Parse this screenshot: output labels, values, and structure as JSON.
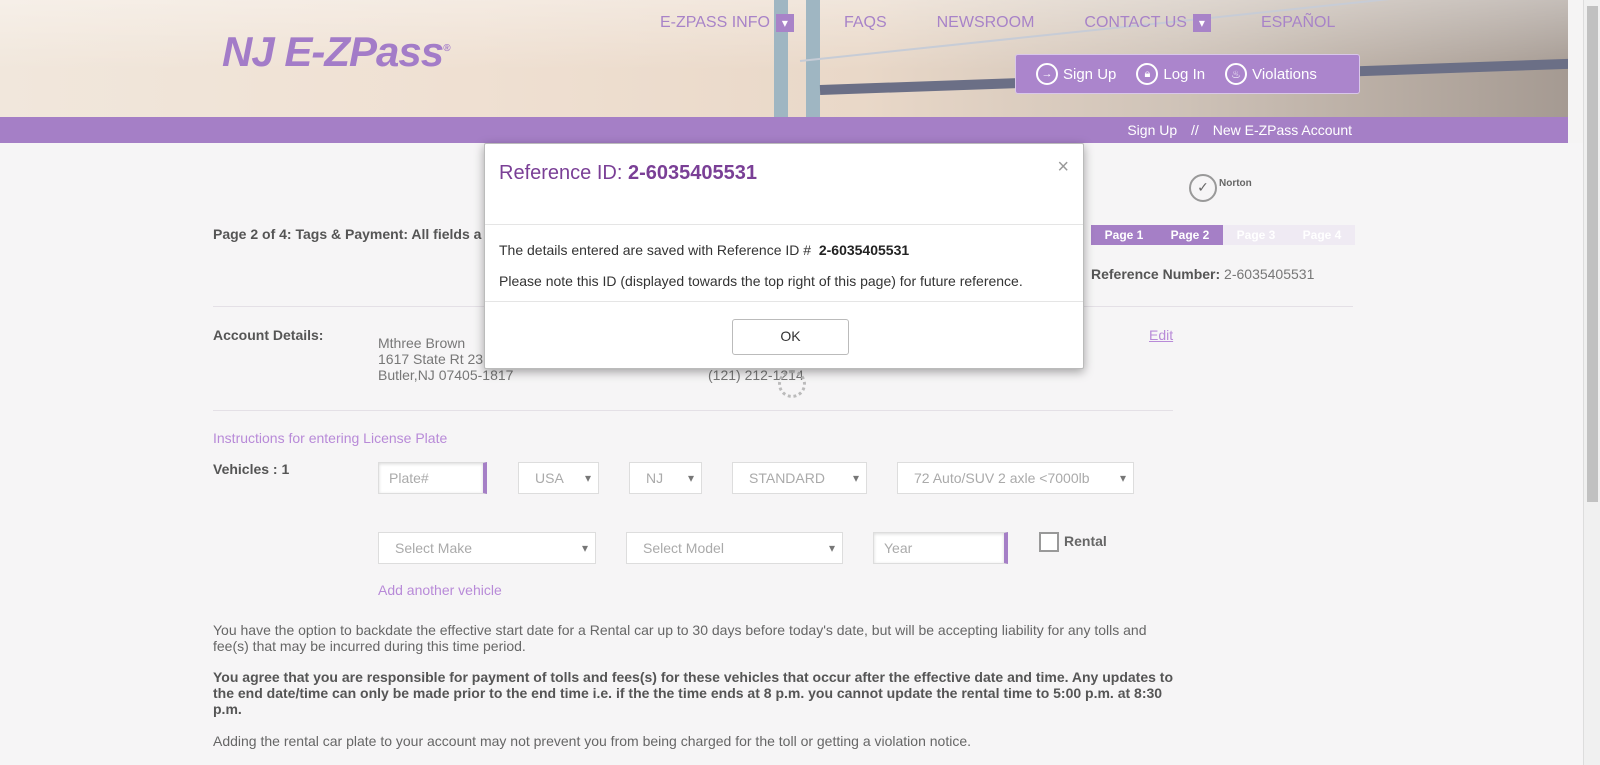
{
  "header": {
    "logo_text": "NJ E-ZPass",
    "logo_reg": "®",
    "nav": [
      {
        "label": "E-ZPASS INFO",
        "has_dropdown": true
      },
      {
        "label": "FAQS",
        "has_dropdown": false
      },
      {
        "label": "NEWSROOM",
        "has_dropdown": false
      },
      {
        "label": "CONTACT US",
        "has_dropdown": true
      },
      {
        "label": "ESPAÑOL",
        "has_dropdown": false
      }
    ],
    "actions": [
      {
        "label": "Sign Up",
        "icon": "arrow-circle-icon"
      },
      {
        "label": "Log In",
        "icon": "lock-icon"
      },
      {
        "label": "Violations",
        "icon": "flame-icon"
      }
    ]
  },
  "breadcrumb": {
    "first": "Sign Up",
    "separator": "//",
    "second": "New E-ZPass Account"
  },
  "page": {
    "page_info": "Page 2 of 4: Tags & Payment: All fields a",
    "norton_label": "Norton",
    "pages": [
      "Page 1",
      "Page 2",
      "Page 3",
      "Page 4"
    ],
    "active_pages": 2,
    "reference_label": "Reference Number:",
    "reference_value": "2-6035405531",
    "account_label": "Account Details:",
    "account_name": "Mthree Brown",
    "account_street": "1617 State Rt 23",
    "account_city": "Butler,NJ 07405-1817",
    "account_phone": "(121) 212-1214",
    "edit_label": "Edit",
    "instructions_link": "Instructions for entering License Plate",
    "vehicles_label": "Vehicles : 1",
    "plate_placeholder": "Plate#",
    "country_value": "USA",
    "state_value": "NJ",
    "plate_type_value": "STANDARD",
    "vehicle_class_value": "72 Auto/SUV 2 axle <7000lb",
    "make_value": "Select Make",
    "model_value": "Select Model",
    "year_placeholder": "Year",
    "rental_label": "Rental",
    "add_vehicle_link": "Add another vehicle",
    "para1": "You have the option to backdate the effective start date for a Rental car up to 30 days before today's date, but will be accepting liability for any tolls and fee(s) that may be incurred during this time period.",
    "para2": "You agree that you are responsible for payment of tolls and fees(s) for these vehicles that occur after the effective date and time. Any updates to the end date/time can only be made prior to the end time i.e. if the the time ends at 8 p.m. you cannot update the rental time to 5:00 p.m. at 8:30 p.m.",
    "para3": "Adding the rental car plate to your account may not prevent you from being charged for the toll or getting a violation notice."
  },
  "modal": {
    "title_prefix": "Reference ID:",
    "title_id": "2-6035405531",
    "close_glyph": "×",
    "line1_text": "The details entered are saved with Reference ID #",
    "line1_id": "2-6035405531",
    "line2_text": "Please note this ID (displayed towards the top right of this page) for future reference.",
    "ok_label": "OK"
  },
  "colors": {
    "brand_purple": "#a57fc6",
    "title_purple": "#7a3f96",
    "link_purple": "#b88ad8"
  }
}
